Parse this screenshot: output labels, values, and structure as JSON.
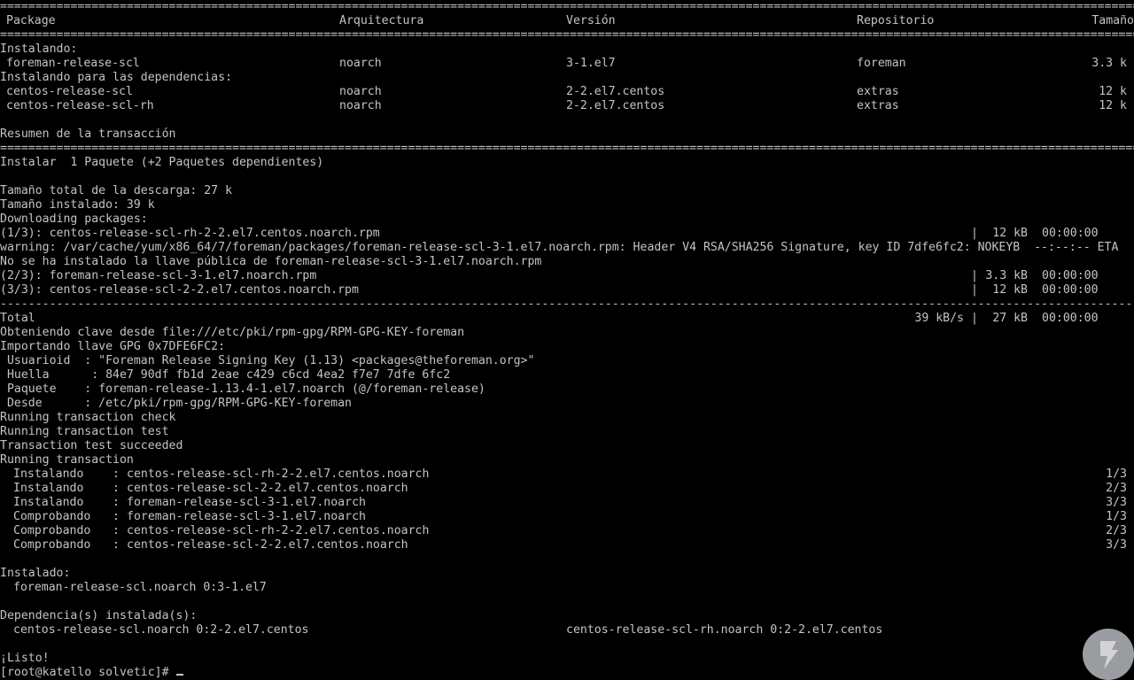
{
  "separator_double": "==========================================================================================================================================================================================================",
  "separator_single": "----------------------------------------------------------------------------------------------------------------------------------------------------------------------------------------------------------",
  "table": {
    "headers": {
      "package": "Package",
      "arch": "Arquitectura",
      "version": "Versión",
      "repo": "Repositorio",
      "size": "Tamaño"
    },
    "section_installing": "Instalando:",
    "section_deps": "Instalando para las dependencias:",
    "installing_rows": [
      {
        "package": "foreman-release-scl",
        "arch": "noarch",
        "version": "3-1.el7",
        "repo": "foreman",
        "size": "3.3 k"
      }
    ],
    "dep_rows": [
      {
        "package": "centos-release-scl",
        "arch": "noarch",
        "version": "2-2.el7.centos",
        "repo": "extras",
        "size": "12 k"
      },
      {
        "package": "centos-release-scl-rh",
        "arch": "noarch",
        "version": "2-2.el7.centos",
        "repo": "extras",
        "size": "12 k"
      }
    ]
  },
  "summary": {
    "title": "Resumen de la transacción",
    "install_line": "Instalar  1 Paquete (+2 Paquetes dependientes)",
    "download_total": "Tamaño total de la descarga: 27 k",
    "installed_size": "Tamaño instalado: 39 k",
    "downloading": "Downloading packages:"
  },
  "downloads": [
    {
      "text": "(1/3): centos-release-scl-rh-2-2.el7.centos.noarch.rpm",
      "bar": "|",
      "size": "12 kB",
      "time": "00:00:00"
    },
    {
      "warning": "warning: /var/cache/yum/x86_64/7/foreman/packages/foreman-release-scl-3-1.el7.noarch.rpm: Header V4 RSA/SHA256 Signature, key ID 7dfe6fc2: NOKEYB  --:--:-- ETA"
    },
    {
      "notice": "No se ha instalado la llave pública de foreman-release-scl-3-1.el7.noarch.rpm"
    },
    {
      "text": "(2/3): foreman-release-scl-3-1.el7.noarch.rpm",
      "bar": "|",
      "size": "3.3 kB",
      "time": "00:00:00"
    },
    {
      "text": "(3/3): centos-release-scl-2-2.el7.centos.noarch.rpm",
      "bar": "|",
      "size": "12 kB",
      "time": "00:00:00"
    }
  ],
  "total": {
    "label": "Total",
    "rate": "39 kB/s",
    "bar": "|",
    "size": "27 kB",
    "time": "00:00:00"
  },
  "gpg": {
    "obtaining": "Obteniendo clave desde file:///etc/pki/rpm-gpg/RPM-GPG-KEY-foreman",
    "importing": "Importando llave GPG 0x7DFE6FC2:",
    "user": " Usuarioid  : \"Foreman Release Signing Key (1.13) <packages@theforeman.org>\"",
    "fingerprint": " Huella      : 84e7 90df fb1d 2eae c429 c6cd 4ea2 f7e7 7dfe 6fc2",
    "package": " Paquete    : foreman-release-1.13.4-1.el7.noarch (@/foreman-release)",
    "from": " Desde      : /etc/pki/rpm-gpg/RPM-GPG-KEY-foreman"
  },
  "run": {
    "check": "Running transaction check",
    "test": "Running transaction test",
    "succeeded": "Transaction test succeeded",
    "transaction": "Running transaction"
  },
  "transaction_steps": [
    {
      "op": "Instalando",
      "pkg": "centos-release-scl-rh-2-2.el7.centos.noarch",
      "count": "1/3"
    },
    {
      "op": "Instalando",
      "pkg": "centos-release-scl-2-2.el7.centos.noarch",
      "count": "2/3"
    },
    {
      "op": "Instalando",
      "pkg": "foreman-release-scl-3-1.el7.noarch",
      "count": "3/3"
    },
    {
      "op": "Comprobando",
      "pkg": "foreman-release-scl-3-1.el7.noarch",
      "count": "1/3"
    },
    {
      "op": "Comprobando",
      "pkg": "centos-release-scl-rh-2-2.el7.centos.noarch",
      "count": "2/3"
    },
    {
      "op": "Comprobando",
      "pkg": "centos-release-scl-2-2.el7.centos.noarch",
      "count": "3/3"
    }
  ],
  "result": {
    "installed_label": "Instalado:",
    "installed_pkg": "foreman-release-scl.noarch 0:3-1.el7",
    "deps_label": "Dependencia(s) instalada(s):",
    "dep1": "centos-release-scl.noarch 0:2-2.el7.centos",
    "dep2": "centos-release-scl-rh.noarch 0:2-2.el7.centos",
    "done": "¡Listo!",
    "prompt": "[root@katello solvetic]#"
  }
}
